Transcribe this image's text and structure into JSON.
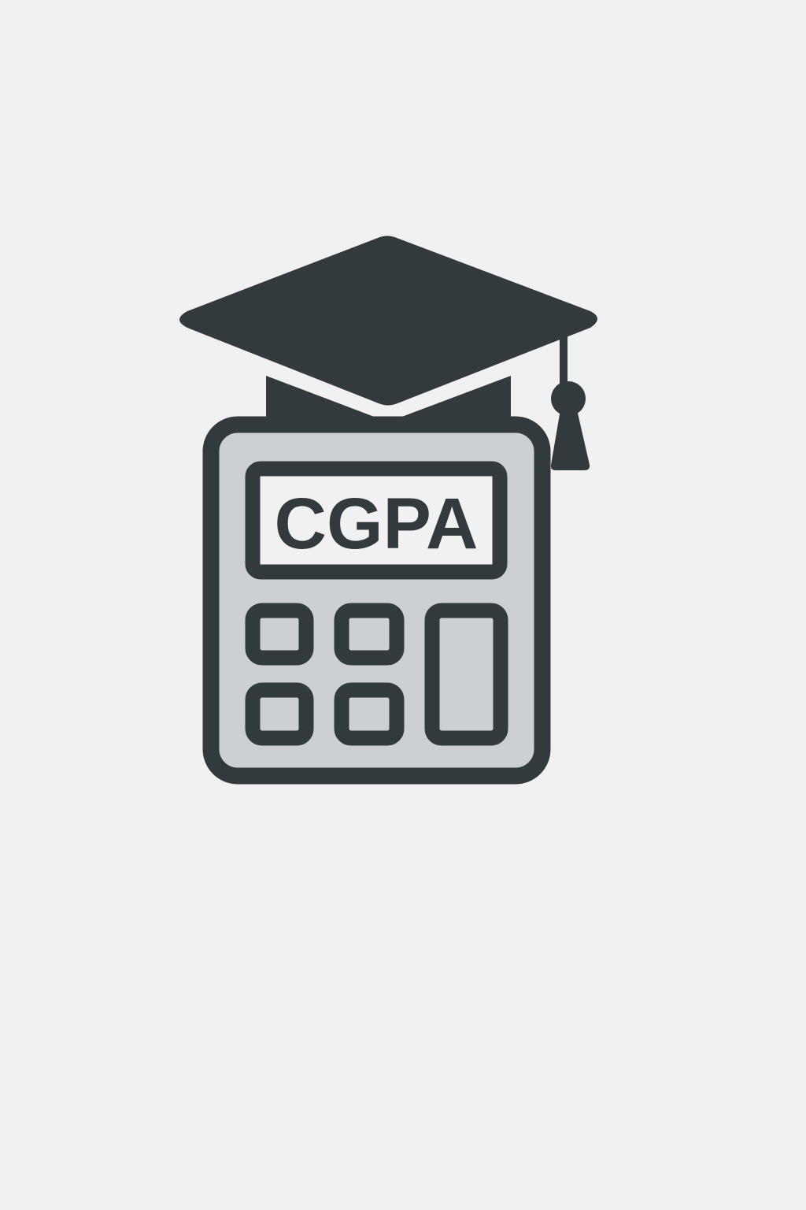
{
  "display": {
    "text": "CGPA"
  },
  "colors": {
    "background": "#f1f1f1",
    "outline": "#323a3e",
    "body_fill": "#cdd0d3",
    "screen_fill": "#f1f1f1"
  },
  "icons": {
    "cap": "graduation-cap-icon",
    "calculator": "calculator-icon"
  }
}
